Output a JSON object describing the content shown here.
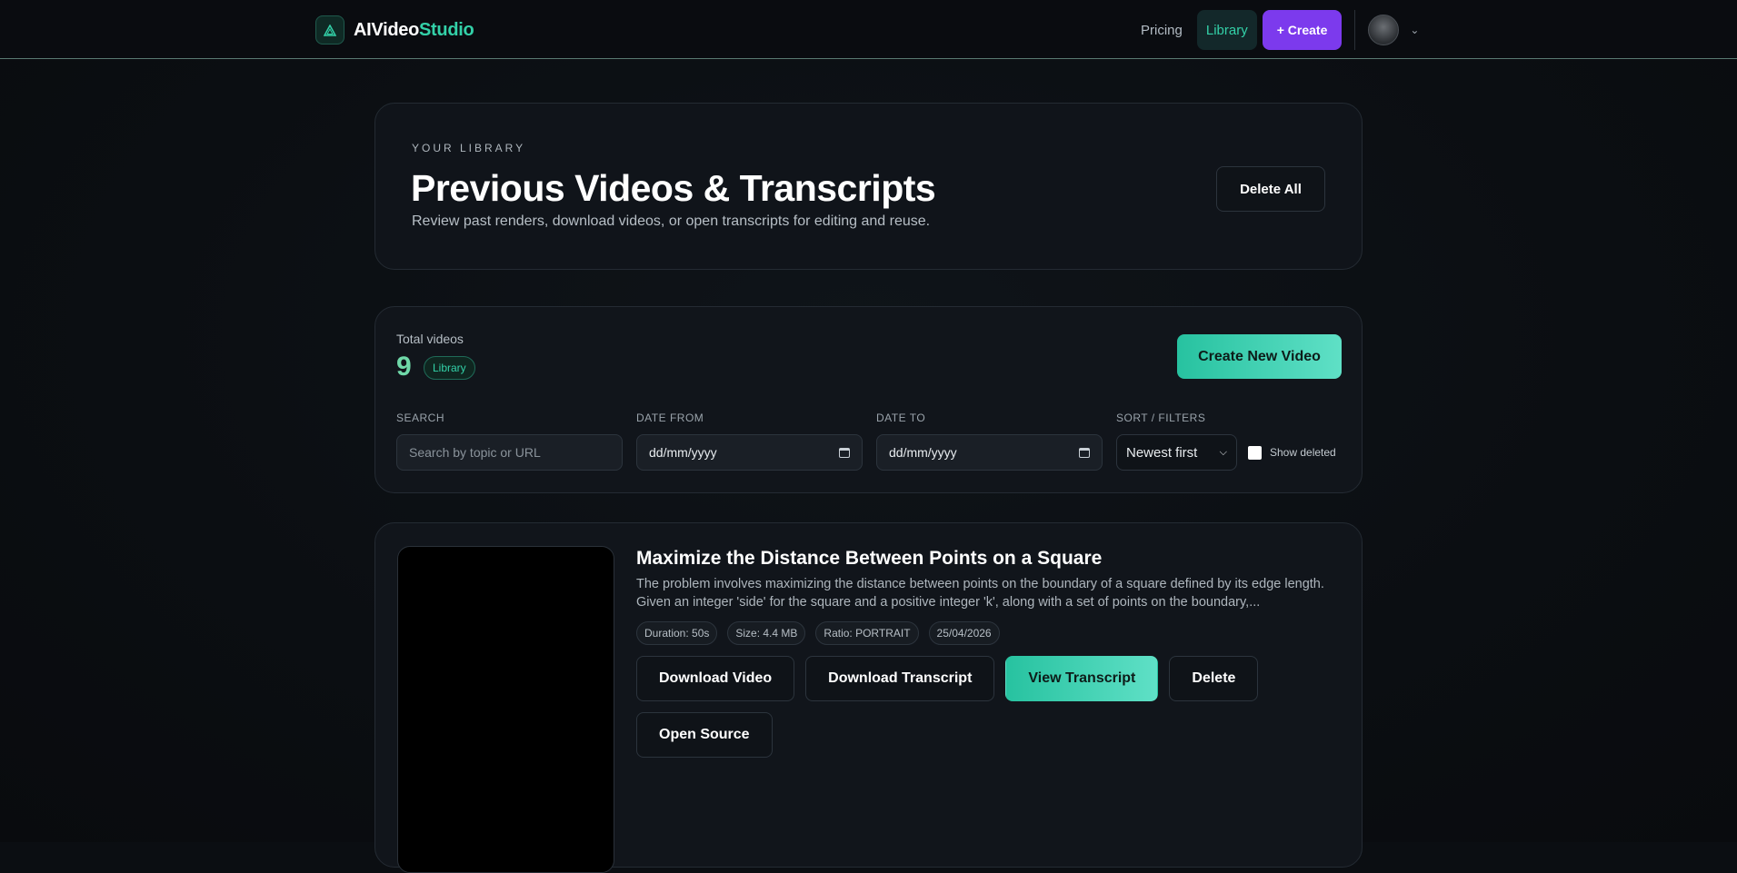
{
  "header": {
    "brand_main": "AIVideo",
    "brand_accent": "Studio",
    "nav": {
      "pricing": "Pricing",
      "library": "Library",
      "create": "+ Create"
    },
    "avatar_icon": "user-avatar-icon"
  },
  "hero": {
    "eyebrow": "YOUR LIBRARY",
    "title": "Previous Videos & Transcripts",
    "subtitle": "Review past renders, download videos, or open transcripts for editing and reuse.",
    "delete_all": "Delete All"
  },
  "stats": {
    "label": "Total videos",
    "count": "9",
    "badge": "Library",
    "create_new": "Create New Video"
  },
  "filters": {
    "search_label": "SEARCH",
    "search_placeholder": "Search by topic or URL",
    "date_from_label": "DATE FROM",
    "date_from_value": "dd/mm/yyyy",
    "date_to_label": "DATE TO",
    "date_to_value": "dd/mm/yyyy",
    "sort_label": "SORT / FILTERS",
    "sort_value": "Newest first",
    "show_deleted_label": "Show deleted",
    "show_deleted_checked": false
  },
  "video": {
    "title": "Maximize the Distance Between Points on a Square",
    "description": "The problem involves maximizing the distance between points on the boundary of a square defined by its edge length. Given an integer 'side' for the square and a positive integer 'k', along with a set of points on the boundary,...",
    "tags": [
      "Duration: 50s",
      "Size: 4.4 MB",
      "Ratio: PORTRAIT",
      "25/04/2026"
    ],
    "actions": {
      "download_video": "Download Video",
      "download_transcript": "Download Transcript",
      "view_transcript": "View Transcript",
      "delete": "Delete",
      "open_source": "Open Source"
    }
  },
  "colors": {
    "accent": "#33d1a8",
    "create_button": "#7c3aed",
    "background": "#0b0e12"
  }
}
